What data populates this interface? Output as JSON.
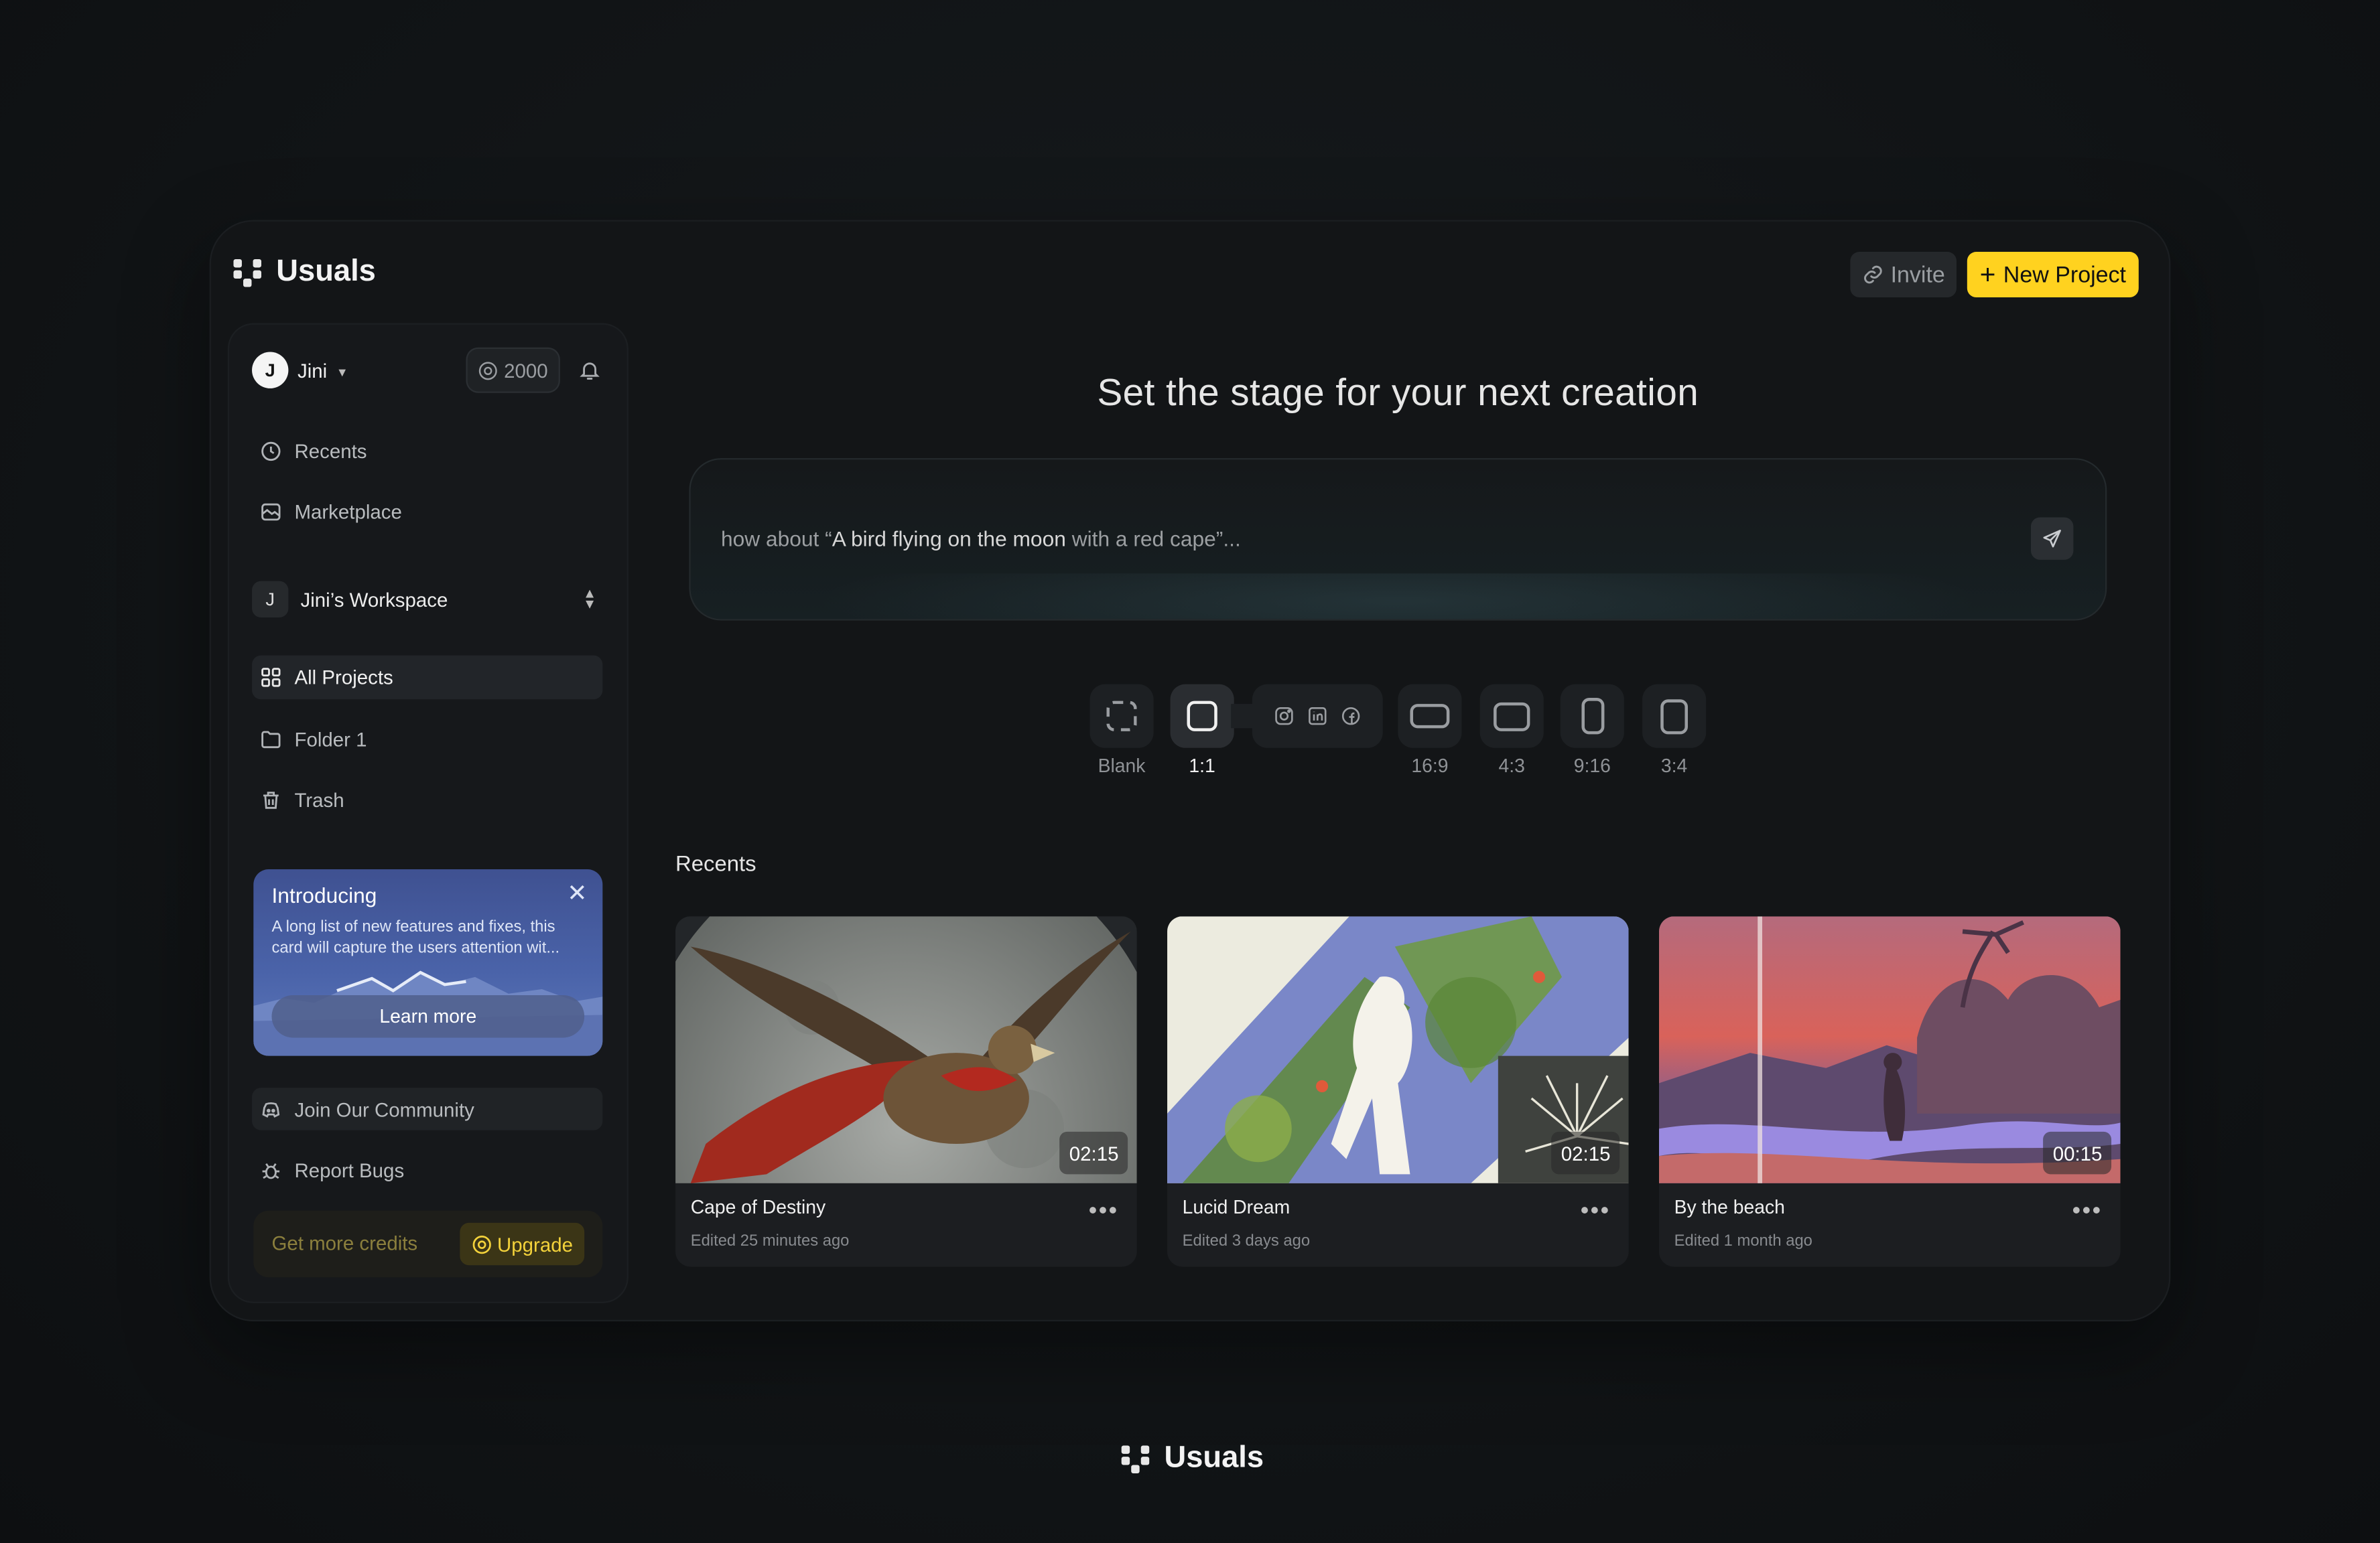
{
  "app": {
    "name": "Usuals"
  },
  "header": {
    "invite_label": "Invite",
    "new_project_label": "New Project"
  },
  "user": {
    "initial": "J",
    "name": "Jini",
    "credits": "2000"
  },
  "nav": {
    "recents": "Recents",
    "marketplace": "Marketplace"
  },
  "workspace": {
    "initial": "J",
    "name": "Jini’s Workspace"
  },
  "folders": {
    "all_projects": "All Projects",
    "folder1": "Folder 1",
    "trash": "Trash"
  },
  "promo": {
    "title": "Introducing",
    "description": "A long list of new features and fixes, this card will capture the users attention wit...",
    "button": "Learn more"
  },
  "footer_links": {
    "community": "Join Our Community",
    "report": "Report Bugs"
  },
  "upgrade": {
    "label": "Get more credits",
    "button": "Upgrade"
  },
  "main": {
    "headline": "Set the stage for your next creation",
    "prompt": {
      "pre": "how about “",
      "quote": "A bird flying on the moon",
      "post": " with a red cape”..."
    }
  },
  "ratios": [
    {
      "label": "Blank"
    },
    {
      "label": "1:1"
    },
    {
      "label": "16:9"
    },
    {
      "label": "4:3"
    },
    {
      "label": "9:16"
    },
    {
      "label": "3:4"
    }
  ],
  "recents": {
    "title": "Recents",
    "items": [
      {
        "title": "Cape of Destiny",
        "edited": "Edited 25 minutes ago",
        "duration": "02:15"
      },
      {
        "title": "Lucid Dream",
        "edited": "Edited 3 days ago",
        "duration": "02:15"
      },
      {
        "title": "By the beach",
        "edited": "Edited 1 month ago",
        "duration": "00:15"
      }
    ]
  },
  "colors": {
    "accent": "#FFD21F",
    "background": "#111416",
    "panel": "#16181B"
  }
}
